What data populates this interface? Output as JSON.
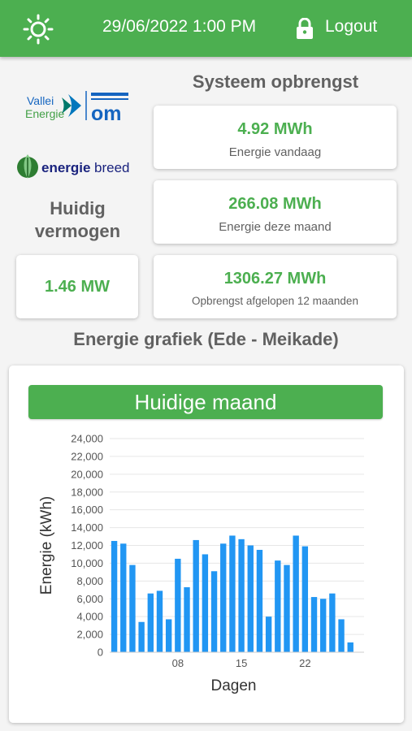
{
  "header": {
    "datetime": "29/06/2022 1:00 PM",
    "logout_label": "Logout",
    "theme_icon": "sun-icon",
    "lock_icon": "lock-icon",
    "color": "#4caf50"
  },
  "logos": {
    "vallei_line1": "Vallei",
    "vallei_line2": "Energie",
    "vallei_mark": "om",
    "energiebreed_part1": "energie",
    "energiebreed_part2": "breed"
  },
  "system": {
    "title": "Systeem opbrengst",
    "today_value": "4.92 MWh",
    "today_label": "Energie vandaag",
    "month_value": "266.08 MWh",
    "month_label": "Energie deze maand",
    "year_value": "1306.27 MWh",
    "year_label": "Opbrengst afgelopen 12 maanden"
  },
  "current": {
    "title_line1": "Huidig",
    "title_line2": "vermogen",
    "value": "1.46 MW"
  },
  "graph": {
    "title": "Energie grafiek (Ede - Meikade)",
    "period_button": "Huidige maand"
  },
  "chart_data": {
    "type": "bar",
    "xlabel": "Dagen",
    "ylabel": "Energie (kWh)",
    "ylim": [
      0,
      24000
    ],
    "yticks": [
      "0",
      "2,000",
      "4,000",
      "6,000",
      "8,000",
      "10,000",
      "12,000",
      "14,000",
      "16,000",
      "18,000",
      "20,000",
      "22,000",
      "24,000"
    ],
    "xtick_labels": [
      {
        "day": 8,
        "label": "08"
      },
      {
        "day": 15,
        "label": "15"
      },
      {
        "day": 22,
        "label": "22"
      }
    ],
    "days": [
      1,
      2,
      3,
      4,
      5,
      6,
      7,
      8,
      9,
      10,
      11,
      12,
      13,
      14,
      15,
      16,
      17,
      18,
      19,
      20,
      21,
      22,
      23,
      24,
      25,
      26,
      27,
      28
    ],
    "values": [
      12500,
      12200,
      9800,
      3400,
      6600,
      6900,
      3700,
      10500,
      7300,
      12600,
      11000,
      9100,
      12200,
      13100,
      12700,
      12000,
      11500,
      4000,
      10300,
      9800,
      13100,
      11900,
      6200,
      6000,
      6600,
      3700,
      1100,
      0
    ],
    "bar_color": "#2196f3",
    "grid": true
  }
}
